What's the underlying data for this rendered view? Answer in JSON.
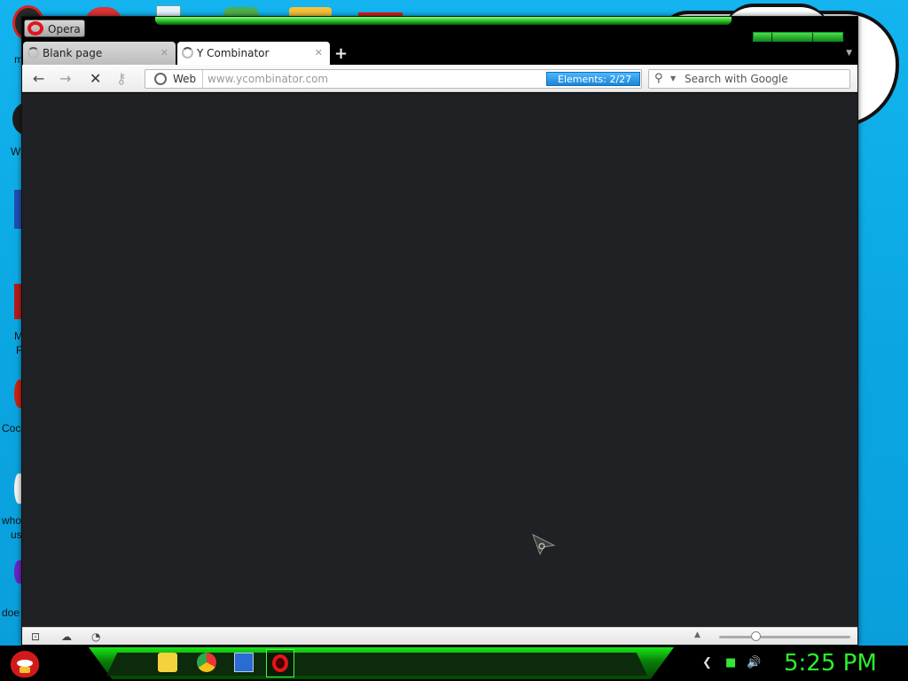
{
  "desktop": {
    "icon_labels": [
      "m",
      "W",
      "M",
      "F",
      "Coc",
      "who",
      "us",
      "doe"
    ]
  },
  "browser": {
    "menu_button": "Opera",
    "tabs": [
      {
        "label": "Blank page",
        "close": "✕"
      },
      {
        "label": "Y Combinator",
        "close": "✕"
      }
    ],
    "new_tab": "+",
    "toolbar": {
      "back": "←",
      "forward": "→",
      "stop": "✕",
      "key": "⚷"
    },
    "address": {
      "scope": "Web",
      "placeholder": "www.ycombinator.com",
      "elements": "Elements:   2/27"
    },
    "search": {
      "placeholder": "Search with Google"
    }
  },
  "taskbar": {
    "clock": "5:25 PM"
  },
  "colors": {
    "accent_green": "#2bf22b",
    "content_bg": "#1f2124",
    "elements_badge": "#1d86d6"
  }
}
